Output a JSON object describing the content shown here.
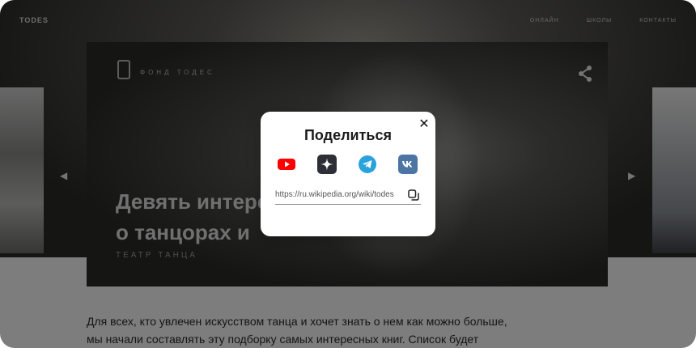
{
  "page": {
    "logo": "TODES",
    "nav": [
      "ОНЛАЙН",
      "ШКОЛЫ",
      "КОНТАКТЫ"
    ],
    "card": {
      "meta": "ФОНД ТОДЕС",
      "title_line1": "Девять интересных фактов",
      "title_line2": "о танцорах и",
      "tag": "ТЕАТР ТАНЦА"
    },
    "article": {
      "line1": "Для всех, кто увлечен искусством танца и хочет знать о нем как можно больше,",
      "line2": "мы начали составлять эту подборку самых интересных книг. Список будет"
    }
  },
  "modal": {
    "title": "Поделиться",
    "close_glyph": "✕",
    "url": "https://ru.wikipedia.org/wiki/todes",
    "icons": [
      "youtube-icon",
      "zen-icon",
      "telegram-icon",
      "vk-icon"
    ],
    "colors": {
      "youtube": "#FF0000",
      "zen": "#2C3036",
      "telegram": "#2AA3DD",
      "vk": "#4C75A3"
    }
  }
}
